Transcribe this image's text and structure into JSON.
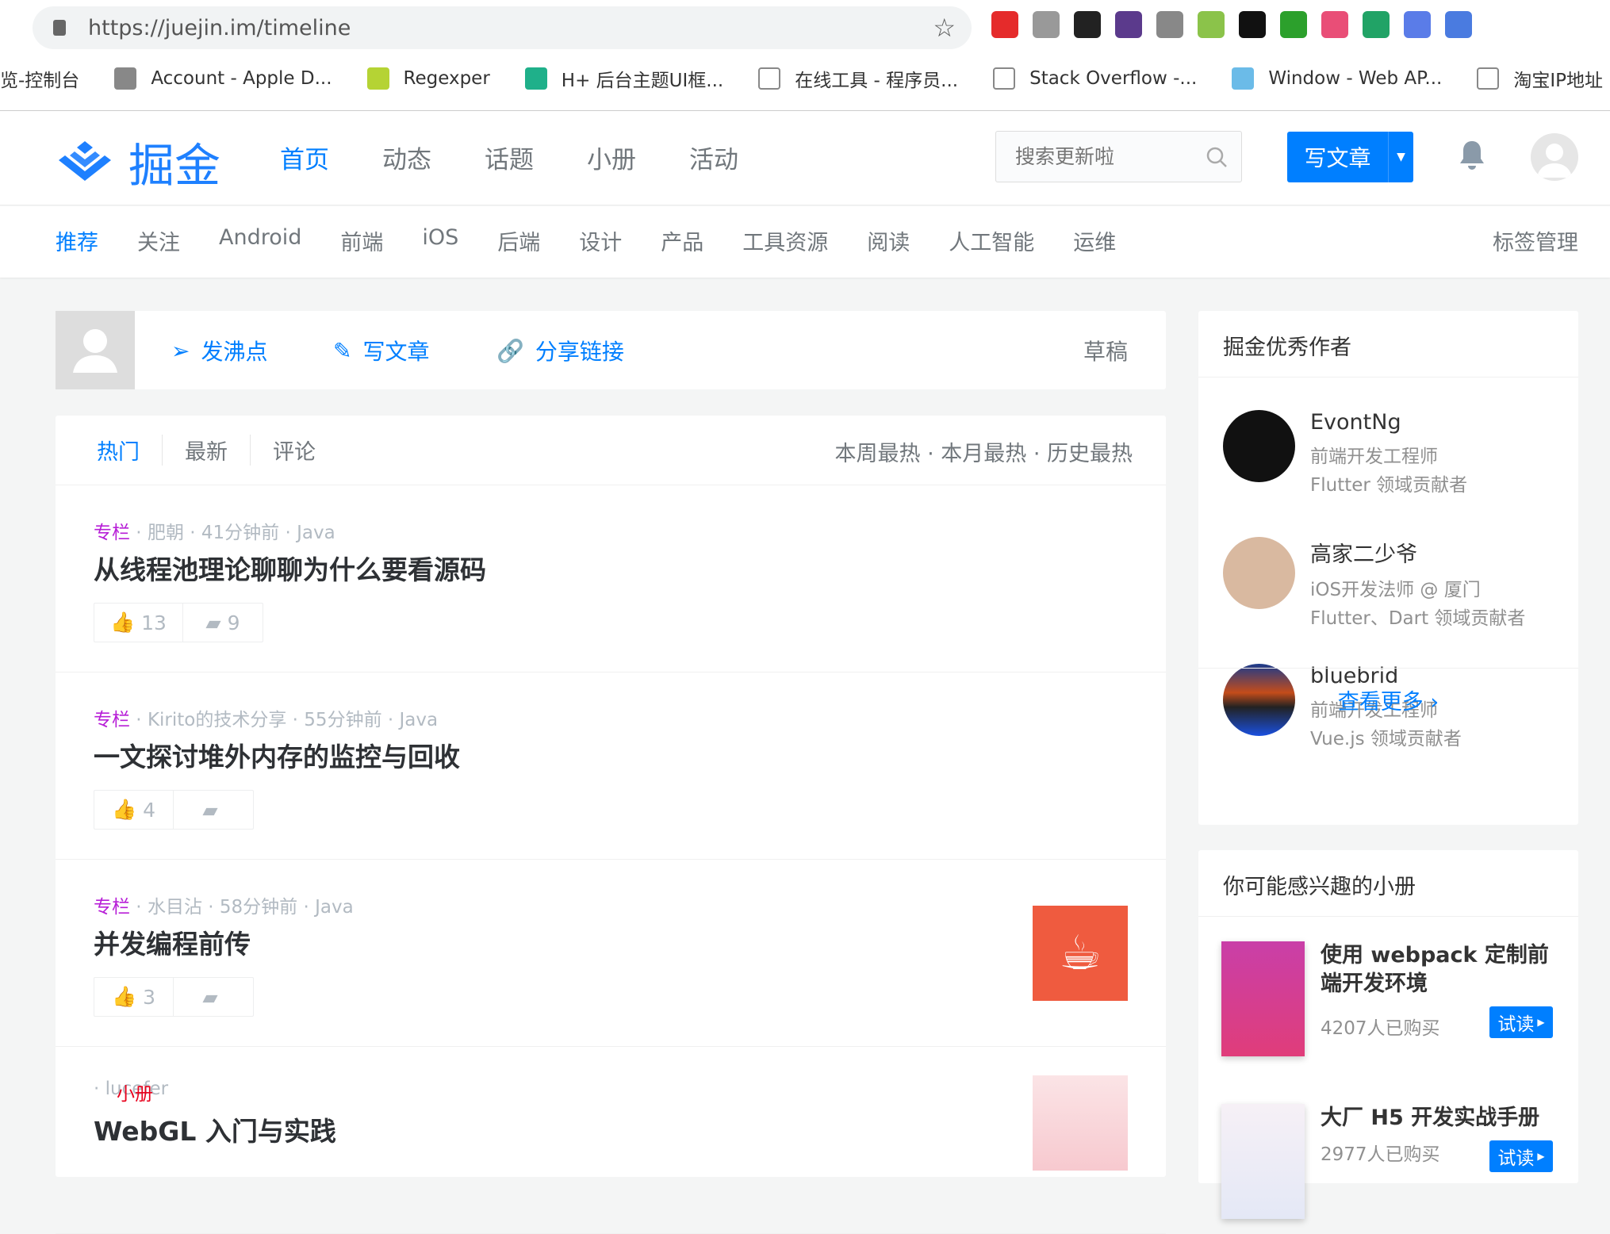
{
  "browser": {
    "url": "https://juejin.im/timeline",
    "bookmarks": [
      "览-控制台",
      "Account - Apple D...",
      "Regexper",
      "H+ 后台主题UI框...",
      "在线工具 - 程序员...",
      "Stack Overflow -...",
      "Window - Web AP...",
      "淘宝IP地址"
    ],
    "extension_colors": [
      "#e52b2b",
      "#999999",
      "#222222",
      "#5b3a8c",
      "#888888",
      "#8bc34a",
      "#111111",
      "#2ca02c",
      "#e94e77",
      "#21a366",
      "#5a7ce8",
      "#4a7be0"
    ]
  },
  "header": {
    "logo_text": "掘金",
    "nav": [
      "首页",
      "动态",
      "话题",
      "小册",
      "活动"
    ],
    "active_nav": 0,
    "search_placeholder": "搜索更新啦",
    "write_label": "写文章"
  },
  "subnav": {
    "items": [
      "推荐",
      "关注",
      "Android",
      "前端",
      "iOS",
      "后端",
      "设计",
      "产品",
      "工具资源",
      "阅读",
      "人工智能",
      "运维"
    ],
    "active": 0,
    "tag_manage": "标签管理"
  },
  "compose": {
    "pin": "发沸点",
    "write": "写文章",
    "share": "分享链接",
    "draft": "草稿"
  },
  "list": {
    "tabs": [
      "热门",
      "最新",
      "评论"
    ],
    "periods": "本周最热 · 本月最热 · 历史最热",
    "articles": [
      {
        "category": "专栏",
        "author": "肥朝",
        "time": "41分钟前",
        "tag": "Java",
        "title": "从线程池理论聊聊为什么要看源码",
        "likes": "13",
        "comments": "9"
      },
      {
        "category": "专栏",
        "author": "Kirito的技术分享",
        "time": "55分钟前",
        "tag": "Java",
        "title": "一文探讨堆外内存的监控与回收",
        "likes": "4",
        "comments": ""
      },
      {
        "category": "专栏",
        "author": "水目沾",
        "time": "58分钟前",
        "tag": "Java",
        "title": "并发编程前传",
        "likes": "3",
        "comments": ""
      },
      {
        "category": "小册",
        "author": "lucefer",
        "title": "WebGL 入门与实践"
      }
    ]
  },
  "authors": {
    "title": "掘金优秀作者",
    "items": [
      {
        "name": "EvontNg",
        "role": "前端开发工程师",
        "domain": "Flutter 领域贡献者"
      },
      {
        "name": "高家二少爷",
        "role": "iOS开发法师 @ 厦门",
        "domain": "Flutter、Dart 领域贡献者"
      },
      {
        "name": "bluebrid",
        "role": "前端开发工程师",
        "domain": "Vue.js 领域贡献者"
      }
    ],
    "more": "查看更多"
  },
  "books": {
    "title": "你可能感兴趣的小册",
    "items": [
      {
        "title": "使用 webpack 定制前端开发环境",
        "sold": "4207人已购买",
        "try": "试读"
      },
      {
        "title": "大厂 H5 开发实战手册",
        "sold": "2977人已购买",
        "try": "试读"
      }
    ]
  }
}
